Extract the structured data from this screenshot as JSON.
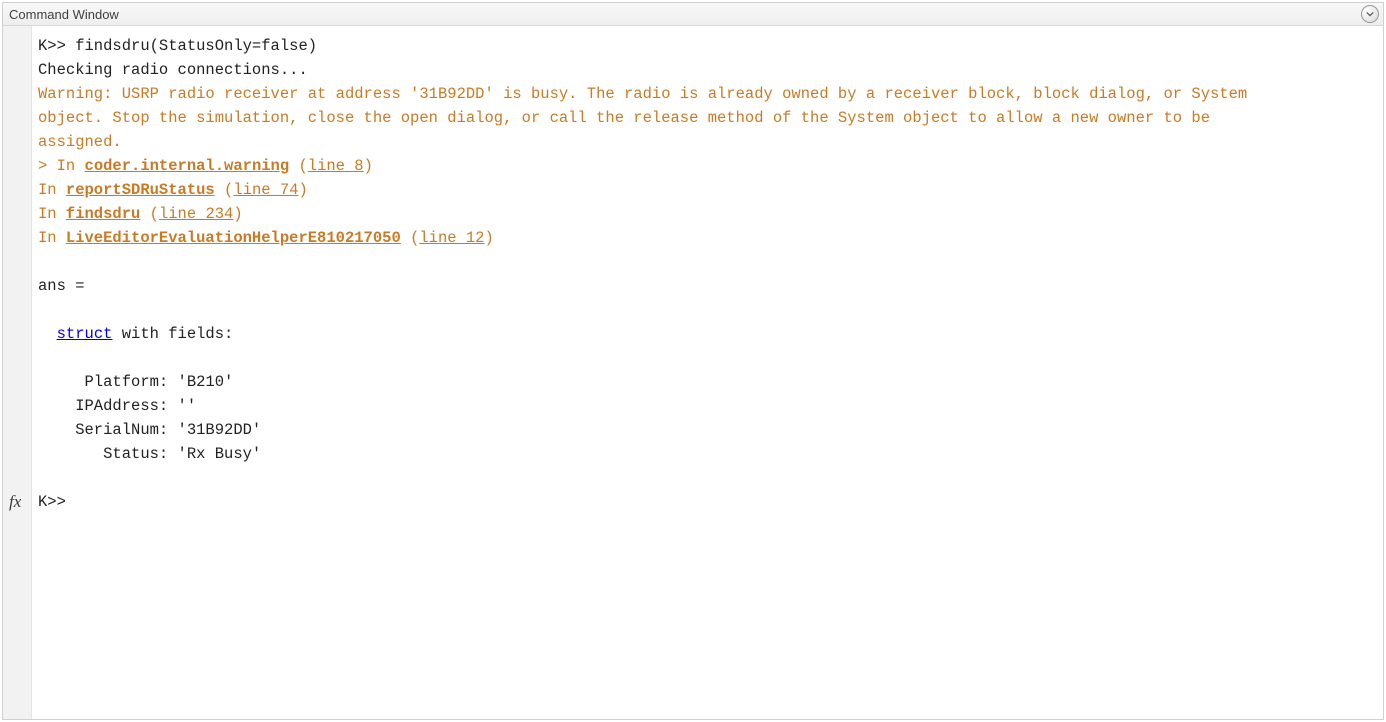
{
  "titlebar": {
    "title": "Command Window"
  },
  "gutter": {
    "fx_label": "fx"
  },
  "console": {
    "prompt": "K>>",
    "command": " findsdru(StatusOnly=false)",
    "checking": "Checking radio connections...",
    "warning_text": "Warning: USRP radio receiver at address '31B92DD' is busy. The radio is already owned by a receiver block, block dialog, or System\nobject. Stop the simulation, close the open dialog, or call the release method of the System object to allow a new owner to be\nassigned. ",
    "trace": [
      {
        "prefix": "> In ",
        "fn": "coder.internal.warning",
        "sep": " (",
        "line_label": "line 8",
        "suffix": ") "
      },
      {
        "prefix": "In ",
        "fn": "reportSDRuStatus",
        "sep": " (",
        "line_label": "line 74",
        "suffix": ") "
      },
      {
        "prefix": "In ",
        "fn": "findsdru",
        "sep": " (",
        "line_label": "line 234",
        "suffix": ") "
      },
      {
        "prefix": "In ",
        "fn": "LiveEditorEvaluationHelperE810217050",
        "sep": " (",
        "line_label": "line 12",
        "suffix": ") "
      }
    ],
    "ans_label": "ans =",
    "struct_indent": "  ",
    "struct_kw": "struct",
    "struct_rest": " with fields:",
    "fields": [
      {
        "line": "     Platform: 'B210'"
      },
      {
        "line": "    IPAddress: ''"
      },
      {
        "line": "    SerialNum: '31B92DD'"
      },
      {
        "line": "       Status: 'Rx Busy'"
      }
    ],
    "final_prompt": "K>> "
  }
}
